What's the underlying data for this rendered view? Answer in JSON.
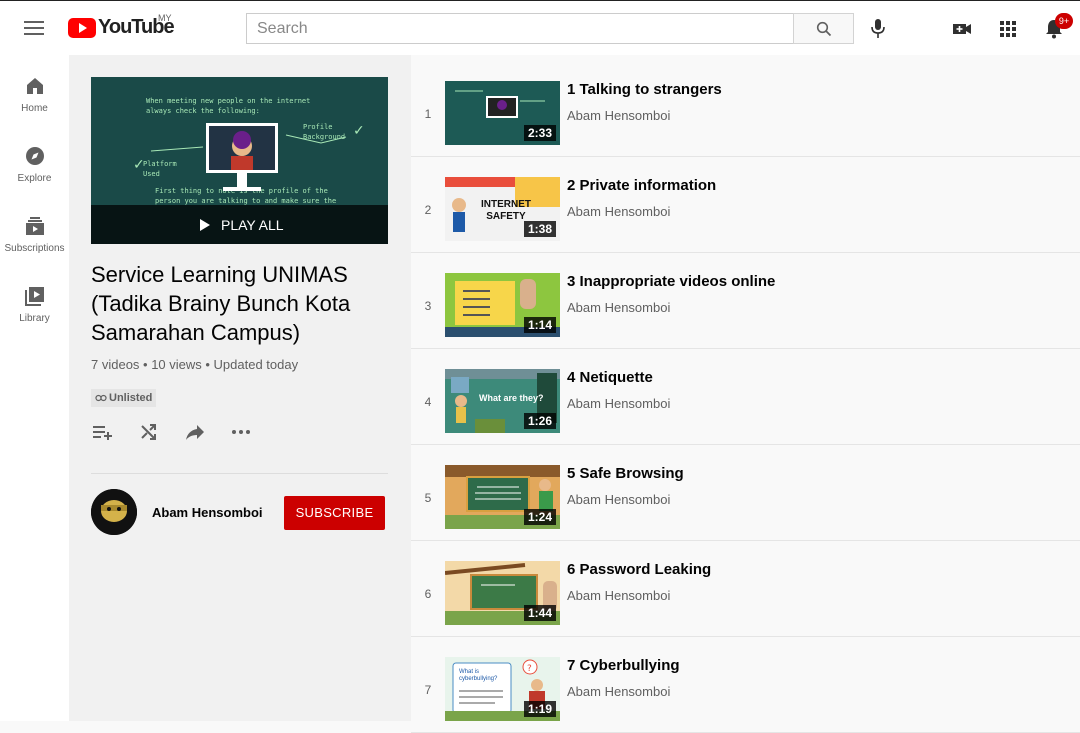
{
  "topbar": {
    "logo_text": "YouTube",
    "country_code": "MY",
    "search_placeholder": "Search",
    "notification_count": "9+"
  },
  "guide": [
    {
      "label": "Home",
      "icon": "home-icon"
    },
    {
      "label": "Explore",
      "icon": "compass-icon"
    },
    {
      "label": "Subscriptions",
      "icon": "subscriptions-icon"
    },
    {
      "label": "Library",
      "icon": "library-icon"
    }
  ],
  "playlist": {
    "play_all": "PLAY ALL",
    "title": "Service Learning UNIMAS (Tadika Brainy Bunch Kota Samarahan Campus)",
    "stats": "7 videos • 10 views • Updated today",
    "privacy": "Unlisted",
    "hero_line1": "When meeting new people on the internet",
    "hero_line2": "always check the following:",
    "hero_profile": "Profile",
    "hero_background": "Background",
    "hero_platform": "Platform",
    "hero_used": "Used",
    "hero_bottom1": "First thing to note is the profile of the",
    "hero_bottom2": "person you are talking to and make sure the"
  },
  "owner": {
    "name": "Abam Hensomboi",
    "subscribe_label": "SUBSCRIBE"
  },
  "videos": [
    {
      "index": "1",
      "title": "1 Talking to strangers",
      "channel": "Abam Hensomboi",
      "duration": "2:33",
      "color": "#1d5a55"
    },
    {
      "index": "2",
      "title": "2 Private information",
      "channel": "Abam Hensomboi",
      "duration": "1:38",
      "color": "#f2f2f2",
      "thumb_text": "INTERNET SAFETY"
    },
    {
      "index": "3",
      "title": "3 Inappropriate videos online",
      "channel": "Abam Hensomboi",
      "duration": "1:14",
      "color": "#8dc63f"
    },
    {
      "index": "4",
      "title": "4 Netiquette",
      "channel": "Abam Hensomboi",
      "duration": "1:26",
      "color": "#3d8a7a",
      "thumb_text": "What are they?"
    },
    {
      "index": "5",
      "title": "5 Safe Browsing",
      "channel": "Abam Hensomboi",
      "duration": "1:24",
      "color": "#2e6b4a"
    },
    {
      "index": "6",
      "title": "6 Password Leaking",
      "channel": "Abam Hensomboi",
      "duration": "1:44",
      "color": "#3c7a47"
    },
    {
      "index": "7",
      "title": "7 Cyberbullying",
      "channel": "Abam Hensomboi",
      "duration": "1:19",
      "color": "#e8f4ec",
      "thumb_text": "What is cyberbullying?"
    }
  ]
}
